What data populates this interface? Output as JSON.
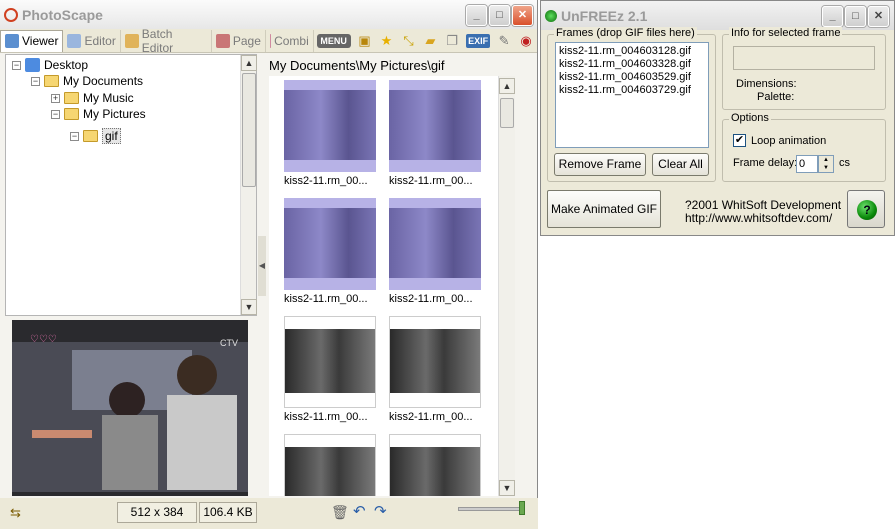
{
  "photoscape": {
    "title": "PhotoScape",
    "tabs": [
      {
        "label": "Viewer"
      },
      {
        "label": "Editor"
      },
      {
        "label": "Batch Editor"
      },
      {
        "label": "Page"
      },
      {
        "label": "Combi"
      }
    ],
    "menu_label": "MENU",
    "exif_label": "EXIF",
    "tree": {
      "desktop": "Desktop",
      "my_documents": "My Documents",
      "my_music": "My Music",
      "my_pictures": "My Pictures",
      "gif": "gif"
    },
    "path": "My Documents\\My Pictures\\gif",
    "thumb_caption": "kiss2-11.rm_00...",
    "status": {
      "dimensions": "512 x 384",
      "size": "106.4 KB"
    }
  },
  "unfreez": {
    "title": "UnFREEz 2.1",
    "frames_label": "Frames (drop GIF files here)",
    "frames": [
      "kiss2-11.rm_004603128.gif",
      "kiss2-11.rm_004603328.gif",
      "kiss2-11.rm_004603529.gif",
      "kiss2-11.rm_004603729.gif"
    ],
    "remove_frame": "Remove Frame",
    "clear_all": "Clear All",
    "info_label": "Info for selected frame",
    "dimensions_label": "Dimensions:",
    "palette_label": "Palette:",
    "options_label": "Options",
    "loop_label": "Loop animation",
    "loop_checked": "✔",
    "frame_delay_label": "Frame delay:",
    "frame_delay_value": "0",
    "cs_label": "cs",
    "make_gif": "Make Animated GIF",
    "copyright": "?2001 WhitSoft Development",
    "website": "http://www.whitsoftdev.com/"
  }
}
